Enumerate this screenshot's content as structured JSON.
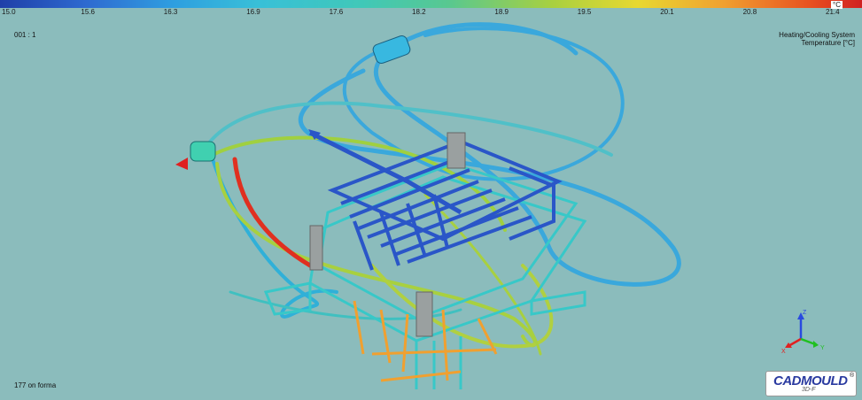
{
  "legend": {
    "ticks": [
      "15.0",
      "15.6",
      "16.3",
      "16.9",
      "17.6",
      "18.2",
      "18.9",
      "19.5",
      "20.1",
      "20.8",
      "21.4"
    ],
    "unit": "°C"
  },
  "viewport": {
    "frame_id": "001 : 1",
    "result_title_line1": "Heating/Cooling System",
    "result_title_line2": "Temperature [°C]",
    "status": "177 on forma"
  },
  "axes": {
    "z": "Z",
    "x": "X",
    "y": "Y"
  },
  "logo": {
    "brand": "CADMOULD",
    "sub": "3D-F",
    "reg": "®"
  },
  "colors": {
    "background": "#8bbcbc",
    "cold": "#1f3fa8",
    "mid": "#40c8b8",
    "hot": "#d02020",
    "orange": "#f0a030"
  }
}
